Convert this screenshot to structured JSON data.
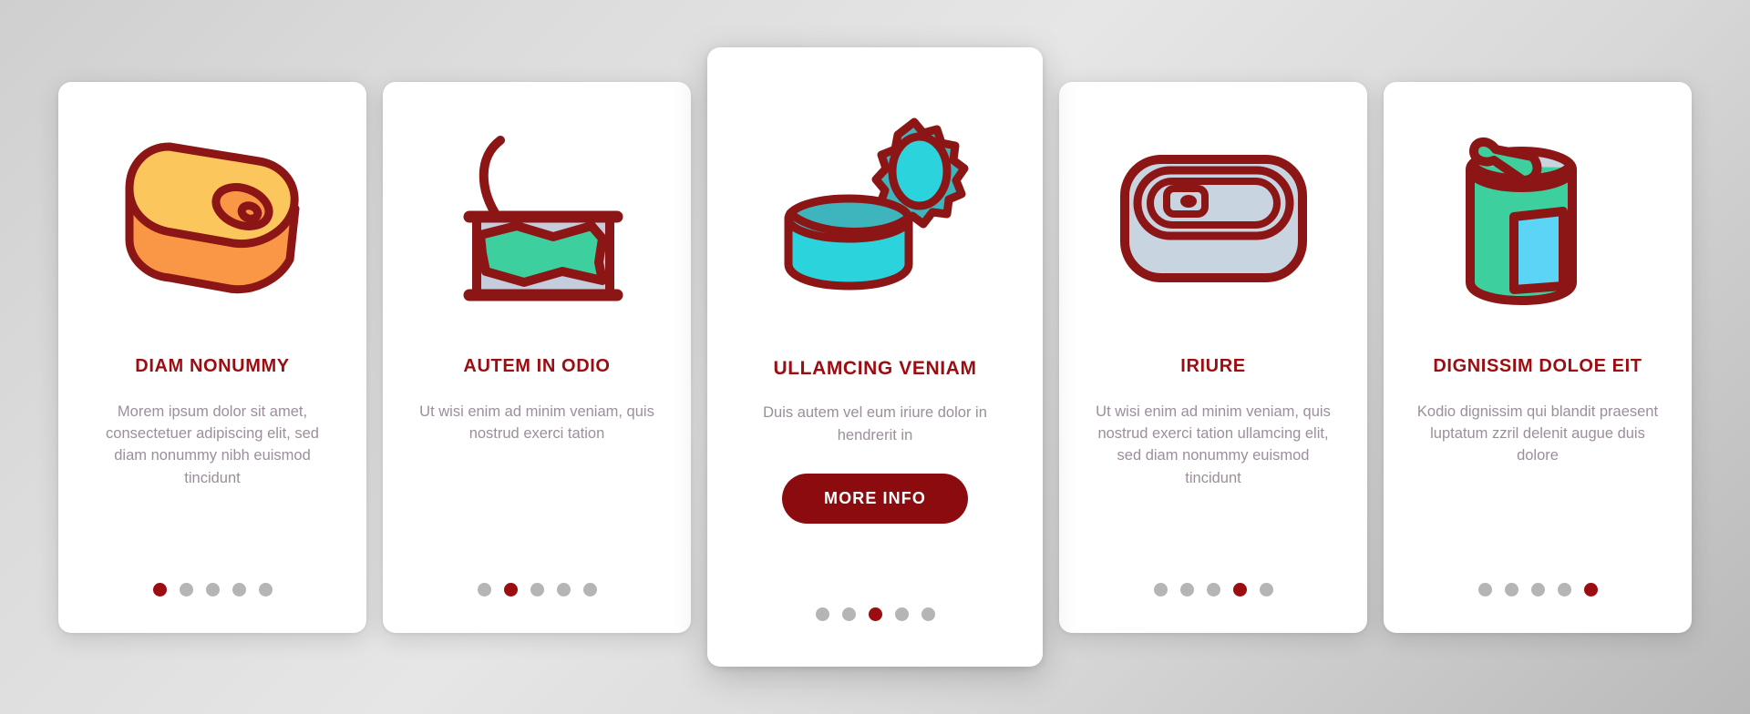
{
  "background": {
    "color_start": "#cfcfcf",
    "color_end": "#b9b9b9"
  },
  "theme": {
    "accent_red": "#9C0D11",
    "button_red": "#8C0B0E",
    "body_text": "#9b8f9b",
    "dot_inactive": "#b5b5b5",
    "card_bg": "#ffffff",
    "icon_outline": "#8C1516",
    "icon_yellow": "#FBC65C",
    "icon_orange": "#F99746",
    "icon_green": "#3ECF9E",
    "icon_cyan": "#2BD3DC",
    "icon_teal": "#3EB5BD",
    "icon_lightblue": "#5BD4F5",
    "icon_gray_blue": "#C8D5E0"
  },
  "cards": [
    {
      "icon": "sardine-can-closed-icon",
      "title": "DIAM NONUMMY",
      "body": "Morem ipsum dolor sit amet, consectetuer adipiscing elit, sed diam nonummy nibh euismod tincidunt",
      "featured": false,
      "button": null,
      "dots": {
        "count": 5,
        "active_index": 0
      }
    },
    {
      "icon": "opened-can-with-food-icon",
      "title": "AUTEM IN ODIO",
      "body": "Ut wisi enim ad minim veniam, quis nostrud exerci tation",
      "featured": false,
      "button": null,
      "dots": {
        "count": 5,
        "active_index": 1
      }
    },
    {
      "icon": "open-tin-can-with-lid-icon",
      "title": "ULLAMCING VENIAM",
      "body": "Duis autem vel eum iriure dolor in hendrerit in",
      "featured": true,
      "button": "MORE INFO",
      "dots": {
        "count": 5,
        "active_index": 2
      }
    },
    {
      "icon": "sardine-tin-flat-icon",
      "title": "IRIURE",
      "body": "Ut wisi enim ad minim veniam, quis nostrud exerci tation ullamcing elit, sed diam nonummy euismod tincidunt",
      "featured": false,
      "button": null,
      "dots": {
        "count": 5,
        "active_index": 3
      }
    },
    {
      "icon": "beverage-can-with-label-icon",
      "title": "DIGNISSIM DOLOE EIT",
      "body": "Kodio dignissim qui blandit praesent luptatum zzril delenit augue duis dolore",
      "featured": false,
      "button": null,
      "dots": {
        "count": 5,
        "active_index": 4
      }
    }
  ]
}
